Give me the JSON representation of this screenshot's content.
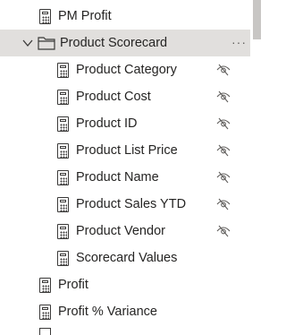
{
  "fields": {
    "top_measure": {
      "label": "PM Profit",
      "icon": "calculator-icon"
    },
    "folder": {
      "label": "Product Scorecard",
      "expanded": true,
      "more_label": "···",
      "icon": "folder-icon"
    },
    "children": [
      {
        "label": "Product Category",
        "hidden": true
      },
      {
        "label": "Product Cost",
        "hidden": true
      },
      {
        "label": "Product ID",
        "hidden": true
      },
      {
        "label": "Product List Price",
        "hidden": true
      },
      {
        "label": "Product Name",
        "hidden": true
      },
      {
        "label": "Product Sales YTD",
        "hidden": true
      },
      {
        "label": "Product Vendor",
        "hidden": true
      },
      {
        "label": "Scorecard Values",
        "hidden": false
      }
    ],
    "bottom_measures": [
      {
        "label": "Profit"
      },
      {
        "label": "Profit % Variance"
      }
    ]
  },
  "colors": {
    "selected_row": "#e1dfdd",
    "icon": "#3b3a39",
    "text": "#252423",
    "scrollbar": "#c8c6c4"
  }
}
